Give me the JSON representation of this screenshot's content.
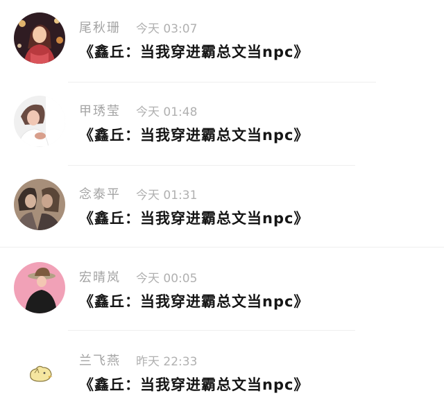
{
  "comments": [
    {
      "author": "尾秋珊",
      "time": "今天 03:07",
      "message": "《鑫丘：当我穿进霸总文当npc》",
      "avatar": "woman-with-lanterns-avatar",
      "avatar_colors": [
        "#3a2126",
        "#b93a3f",
        "#f2a54a",
        "#ffe1b5"
      ]
    },
    {
      "author": "甲琇莹",
      "time": "今天 01:48",
      "message": "《鑫丘：当我穿进霸总文当npc》",
      "avatar": "selfie-woman-avatar",
      "avatar_colors": [
        "#f2f2f2",
        "#6a4b42",
        "#d89f8c",
        "#ffffff"
      ]
    },
    {
      "author": "念泰平",
      "time": "今天 01:31",
      "message": "《鑫丘：当我穿进霸总文当npc》",
      "avatar": "couple-kissing-avatar",
      "avatar_colors": [
        "#a78f7a",
        "#3b2f29",
        "#d3b29b",
        "#6e5e59"
      ]
    },
    {
      "author": "宏晴岚",
      "time": "今天 00:05",
      "message": "《鑫丘：当我穿进霸总文当npc》",
      "avatar": "hat-woman-on-pink-avatar",
      "avatar_colors": [
        "#f1a1b7",
        "#1c1c1c",
        "#7d5a3e",
        "#b3a185"
      ]
    },
    {
      "author": "兰飞燕",
      "time": "昨天 22:33",
      "message": "《鑫丘：当我穿进霸总文当npc》",
      "avatar": "yellow-chick-sticker-avatar",
      "avatar_colors": [
        "#ffffff",
        "#f5e6a0",
        "#8a7a40",
        "#4a4a4a"
      ]
    }
  ]
}
